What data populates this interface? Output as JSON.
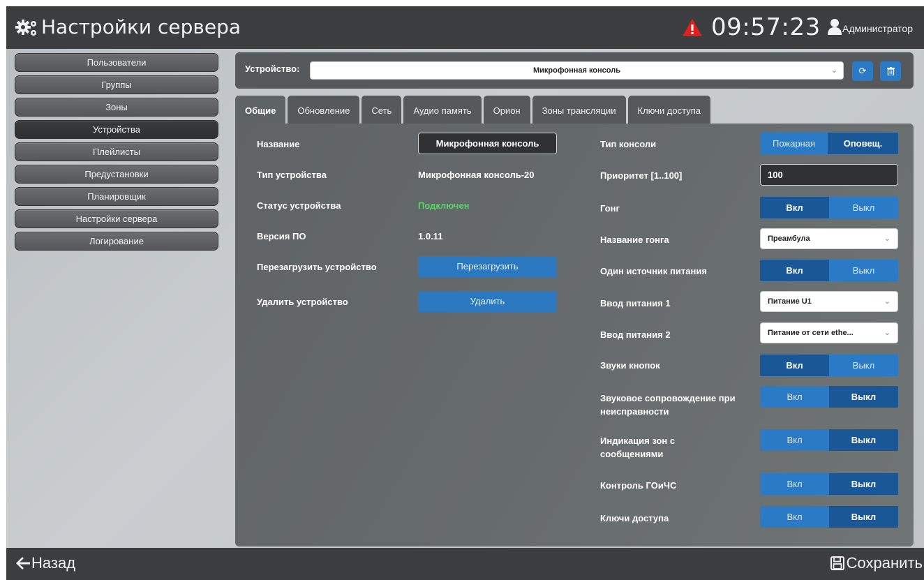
{
  "header": {
    "title": "Настройки сервера",
    "clock": "09:57:23",
    "user": "Администратор",
    "icons": [
      "gears-icon",
      "warning-icon",
      "user-icon"
    ]
  },
  "sidebar": {
    "items": [
      {
        "label": "Пользователи"
      },
      {
        "label": "Группы"
      },
      {
        "label": "Зоны"
      },
      {
        "label": "Устройства"
      },
      {
        "label": "Плейлисты"
      },
      {
        "label": "Предустановки"
      },
      {
        "label": "Планировщик"
      },
      {
        "label": "Настройки сервера"
      },
      {
        "label": "Логирование"
      }
    ],
    "active_index": 3
  },
  "device": {
    "label": "Устройство:",
    "selected": "Микрофонная консоль"
  },
  "tabs": [
    {
      "label": "Общие"
    },
    {
      "label": "Обновление"
    },
    {
      "label": "Сеть"
    },
    {
      "label": "Аудио память"
    },
    {
      "label": "Орион"
    },
    {
      "label": "Зоны трансляции"
    },
    {
      "label": "Ключи доступа"
    }
  ],
  "general": {
    "name_label": "Название",
    "name_value": "Микрофонная консоль",
    "type_label": "Тип устройства",
    "type_value": "Микрофонная консоль-20",
    "status_label": "Статус устройства",
    "status_value": "Подключен",
    "fw_label": "Версия ПО",
    "fw_value": "1.0.11",
    "reboot_label": "Перезагрузить устройство",
    "reboot_button": "Перезагрузить",
    "delete_label": "Удалить устройство",
    "delete_button": "Удалить"
  },
  "settings": {
    "console_type": {
      "label": "Тип консоли",
      "left": "Пожарная",
      "right": "Оповещ."
    },
    "priority": {
      "label": "Приоритет [1..100]",
      "value": "100"
    },
    "gong": {
      "label": "Гонг",
      "on": "Вкл",
      "off": "Выкл"
    },
    "gong_name": {
      "label": "Название гонга",
      "value": "Преамбула"
    },
    "single_power": {
      "label": "Один источник питания",
      "on": "Вкл",
      "off": "Выкл"
    },
    "power_in_1": {
      "label": "Ввод питания 1",
      "value": "Питание U1"
    },
    "power_in_2": {
      "label": "Ввод питания 2",
      "value": "Питание от сети ethe..."
    },
    "key_sounds": {
      "label": "Звуки кнопок",
      "on": "Вкл",
      "off": "Выкл"
    },
    "fault_sound": {
      "label": "Звуковое сопровождение при неисправности",
      "on": "Вкл",
      "off": "Выкл"
    },
    "zone_indication": {
      "label": "Индикация зон с сообщениями",
      "on": "Вкл",
      "off": "Выкл"
    },
    "gochs_control": {
      "label": "Контроль ГОиЧС",
      "on": "Вкл",
      "off": "Выкл"
    },
    "access_keys": {
      "label": "Ключи доступа",
      "on": "Вкл",
      "off": "Выкл"
    }
  },
  "footer": {
    "back": "Назад",
    "save": "Сохранить"
  },
  "colors": {
    "header_bg": "#3b3d3f",
    "accent": "#2b7ac6",
    "accent_active": "#1a5796",
    "status_ok": "#5ed16c",
    "warning": "#e02020"
  }
}
